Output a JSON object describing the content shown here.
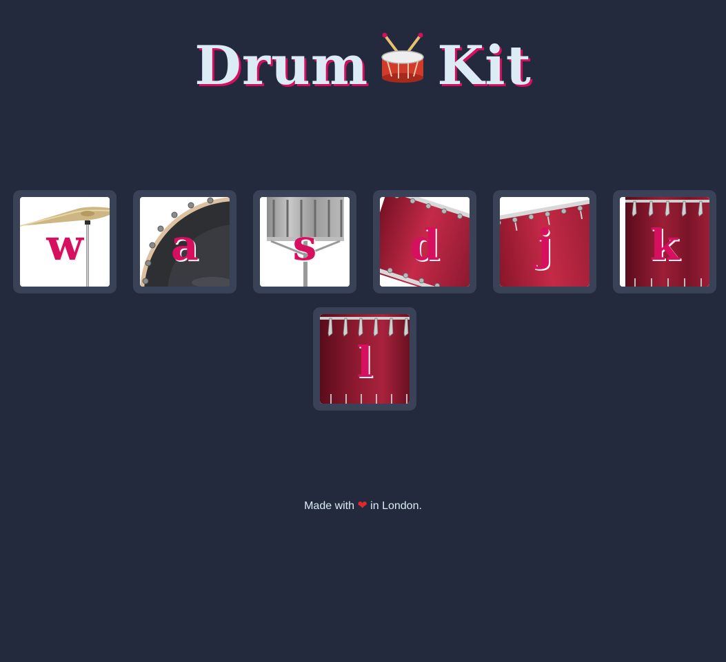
{
  "header": {
    "title_left": "Drum",
    "title_icon": "drum-icon",
    "title_right": "Kit"
  },
  "pads": [
    {
      "key": "w",
      "instrument_icon": "cymbal-icon"
    },
    {
      "key": "a",
      "instrument_icon": "bass-drum-icon"
    },
    {
      "key": "s",
      "instrument_icon": "snare-drum-icon"
    },
    {
      "key": "d",
      "instrument_icon": "tom-drum-icon"
    },
    {
      "key": "j",
      "instrument_icon": "tom-drum-icon"
    },
    {
      "key": "k",
      "instrument_icon": "floor-tom-icon"
    },
    {
      "key": "l",
      "instrument_icon": "floor-tom-icon"
    }
  ],
  "footer": {
    "text_before": "Made with",
    "heart_icon": "heart-icon",
    "text_after": "in London."
  },
  "colors": {
    "background": "#232a3d",
    "pad_frame": "#3a4258",
    "accent": "#d6105e",
    "title_text": "#dcecf6",
    "drum_red": "#b21c3a"
  }
}
